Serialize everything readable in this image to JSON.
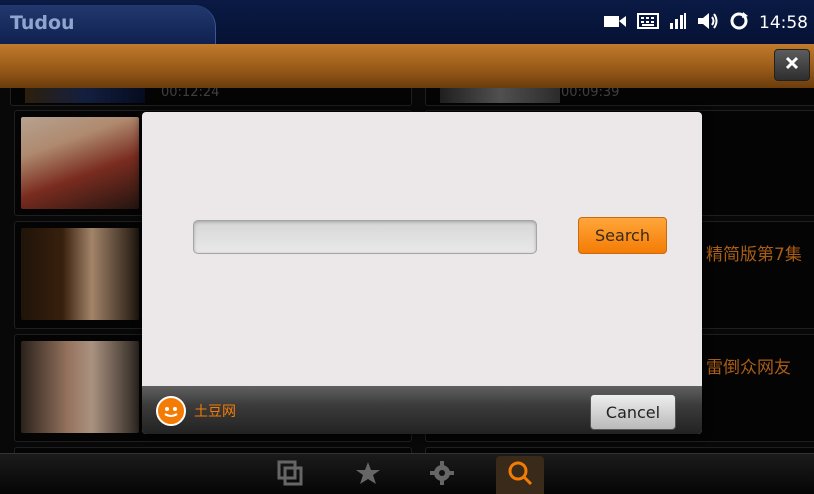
{
  "status_bar": {
    "app_title": "Tudou",
    "time": "14:58",
    "icons": [
      "camera-icon",
      "keyboard-icon",
      "signal-icon",
      "volume-icon",
      "sync-icon"
    ]
  },
  "title_bar": {
    "close_icon": "close-icon"
  },
  "video_list": {
    "durations": [
      "00:12:24",
      "00:09:39"
    ],
    "right_titles": [
      "精简版第7集",
      "雷倒众网友"
    ]
  },
  "search_dialog": {
    "search_value": "",
    "search_label": "Search",
    "cancel_label": "Cancel",
    "brand": "土豆网"
  },
  "bottom_nav": {
    "items": [
      "windows-icon",
      "star-icon",
      "gear-icon",
      "search-icon"
    ],
    "active": "search-icon"
  },
  "colors": {
    "accent": "#f47c05",
    "status_bar": "#061235",
    "title_bar": "#9a5b19"
  }
}
